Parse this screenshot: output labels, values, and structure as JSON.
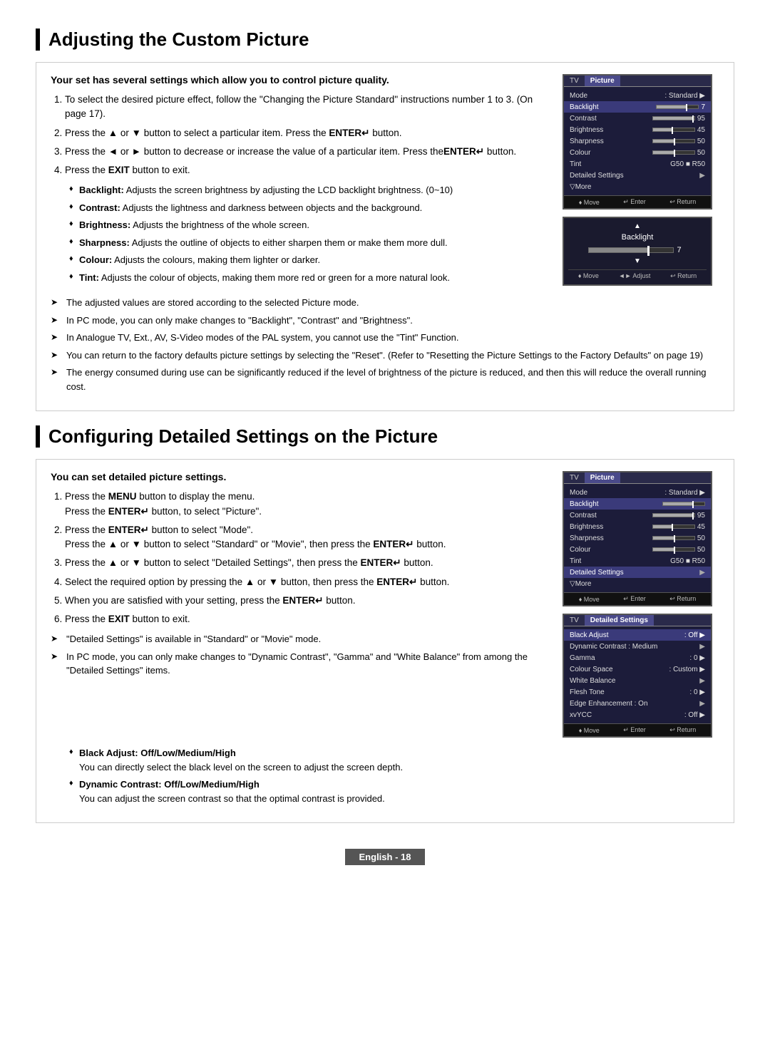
{
  "section1": {
    "title": "Adjusting the Custom Picture",
    "intro": "Your set has several settings which allow you to control picture quality.",
    "steps": [
      "To select the desired picture effect, follow the \"Changing the Picture Standard\" instructions number 1 to 3. (On page 17).",
      "Press the ▲ or ▼ button to select a particular item. Press the ENTER↵ button.",
      "Press the ◄ or ► button to decrease or increase the value of a particular item. Press theENTER↵ button.",
      "Press the EXIT button to exit."
    ],
    "bullets": [
      {
        "label": "Backlight",
        "text": "Adjusts the screen brightness by adjusting the LCD backlight brightness. (0~10)"
      },
      {
        "label": "Contrast",
        "text": "Adjusts the lightness and darkness between objects and the background."
      },
      {
        "label": "Brightness",
        "text": "Adjusts the brightness of the whole screen."
      },
      {
        "label": "Sharpness",
        "text": "Adjusts the outline of objects to either sharpen them or make them more dull."
      },
      {
        "label": "Colour",
        "text": "Adjusts the colours, making them lighter or darker."
      },
      {
        "label": "Tint",
        "text": "Adjusts the colour of objects, making them more red or green for a more natural look."
      }
    ],
    "notes": [
      "The adjusted values are stored according to the selected Picture mode.",
      "In PC mode, you can only make changes to \"Backlight\", \"Contrast\" and \"Brightness\".",
      "In Analogue TV, Ext., AV, S-Video modes of the PAL system, you cannot use the \"Tint\" Function.",
      "You can return to the factory defaults picture settings by selecting the \"Reset\". (Refer to \"Resetting the Picture Settings to the Factory Defaults\" on page 19)",
      "The energy consumed during use can be significantly reduced if the level of brightness of the picture is reduced, and then this will reduce the overall running cost."
    ],
    "screen1": {
      "tab": "Picture",
      "rows": [
        {
          "label": "Mode",
          "value": ": Standard",
          "hasArrow": true,
          "bar": false
        },
        {
          "label": "Backlight",
          "value": "7",
          "hasArrow": false,
          "bar": true,
          "fill": 70,
          "highlight": true
        },
        {
          "label": "Contrast",
          "value": "95",
          "hasArrow": false,
          "bar": true,
          "fill": 95
        },
        {
          "label": "Brightness",
          "value": "45",
          "hasArrow": false,
          "bar": true,
          "fill": 45
        },
        {
          "label": "Sharpness",
          "value": "50",
          "hasArrow": false,
          "bar": true,
          "fill": 50
        },
        {
          "label": "Colour",
          "value": "50",
          "hasArrow": false,
          "bar": true,
          "fill": 50
        },
        {
          "label": "Tint",
          "value": "G50 ■ R50",
          "hasArrow": false,
          "bar": false
        },
        {
          "label": "Detailed Settings",
          "value": "",
          "hasArrow": true,
          "bar": false
        },
        {
          "label": "▽More",
          "value": "",
          "hasArrow": false,
          "bar": false
        }
      ],
      "footer": [
        "♦ Move",
        "↵ Enter",
        "↩ Return"
      ]
    },
    "screen2": {
      "label": "Backlight",
      "value": "7",
      "fill": 70,
      "footer": [
        "♦ Move",
        "◄► Adjust",
        "↩ Return"
      ]
    }
  },
  "section2": {
    "title": "Configuring Detailed Settings on the Picture",
    "intro": "You can set detailed picture settings.",
    "steps": [
      {
        "text": "Press the MENU button to display the menu.\nPress the ENTER↵ button, to select \"Picture\"."
      },
      {
        "text": "Press the ENTER↵ button to select \"Mode\".\nPress the ▲ or ▼ button to select \"Standard\" or \"Movie\", then press the ENTER↵ button."
      },
      {
        "text": "Press the ▲ or ▼ button to select \"Detailed Settings\", then press the ENTER↵ button."
      },
      {
        "text": "Select the required option by pressing the ▲ or ▼ button, then press the ENTER↵ button."
      },
      {
        "text": "When you are satisfied with your setting, press the ENTER↵ button."
      },
      {
        "text": "Press the EXIT button to exit."
      }
    ],
    "notes": [
      "\"Detailed Settings\" is available in \"Standard\" or \"Movie\" mode.",
      "In PC mode, you can only make changes to \"Dynamic Contrast\", \"Gamma\" and \"White Balance\" from among the \"Detailed Settings\" items."
    ],
    "screen1": {
      "tab": "Picture",
      "rows": [
        {
          "label": "Mode",
          "value": ": Standard",
          "hasArrow": true,
          "bar": false
        },
        {
          "label": "Backlight",
          "value": "",
          "hasArrow": false,
          "bar": true,
          "fill": 70,
          "highlight": true
        },
        {
          "label": "Contrast",
          "value": "95",
          "hasArrow": false,
          "bar": true,
          "fill": 95
        },
        {
          "label": "Brightness",
          "value": "45",
          "hasArrow": false,
          "bar": true,
          "fill": 45
        },
        {
          "label": "Sharpness",
          "value": "50",
          "hasArrow": false,
          "bar": true,
          "fill": 50
        },
        {
          "label": "Colour",
          "value": "50",
          "hasArrow": false,
          "bar": true,
          "fill": 50
        },
        {
          "label": "Tint",
          "value": "G50 ■ R50",
          "hasArrow": false,
          "bar": false
        },
        {
          "label": "Detailed Settings",
          "value": "",
          "hasArrow": true,
          "bar": false,
          "highlight": true
        },
        {
          "label": "▽More",
          "value": "",
          "hasArrow": false,
          "bar": false
        }
      ],
      "footer": [
        "♦ Move",
        "↵ Enter",
        "↩ Return"
      ]
    },
    "screen2": {
      "title": "Detailed Settings",
      "rows": [
        {
          "label": "Black Adjust",
          "value": ": Off",
          "hasArrow": true
        },
        {
          "label": "Dynamic Contrast",
          "value": ": Medium",
          "hasArrow": true
        },
        {
          "label": "Gamma",
          "value": ": 0",
          "hasArrow": true
        },
        {
          "label": "Colour Space",
          "value": ": Custom",
          "hasArrow": true
        },
        {
          "label": "White Balance",
          "value": "",
          "hasArrow": true
        },
        {
          "label": "Flesh Tone",
          "value": ": 0",
          "hasArrow": true
        },
        {
          "label": "Edge Enhancement",
          "value": ": On",
          "hasArrow": true
        },
        {
          "label": "xvYCC",
          "value": ": Off",
          "hasArrow": true
        }
      ],
      "footer": [
        "♦ Move",
        "↵ Enter",
        "↩ Return"
      ]
    },
    "bullets": [
      {
        "label": "Black Adjust: Off/Low/Medium/High",
        "text": "You can directly select the black level on the screen to adjust the screen depth."
      },
      {
        "label": "Dynamic Contrast: Off/Low/Medium/High",
        "text": "You can adjust the screen contrast so that the optimal contrast is provided."
      }
    ]
  },
  "footer": {
    "label": "English - 18"
  }
}
